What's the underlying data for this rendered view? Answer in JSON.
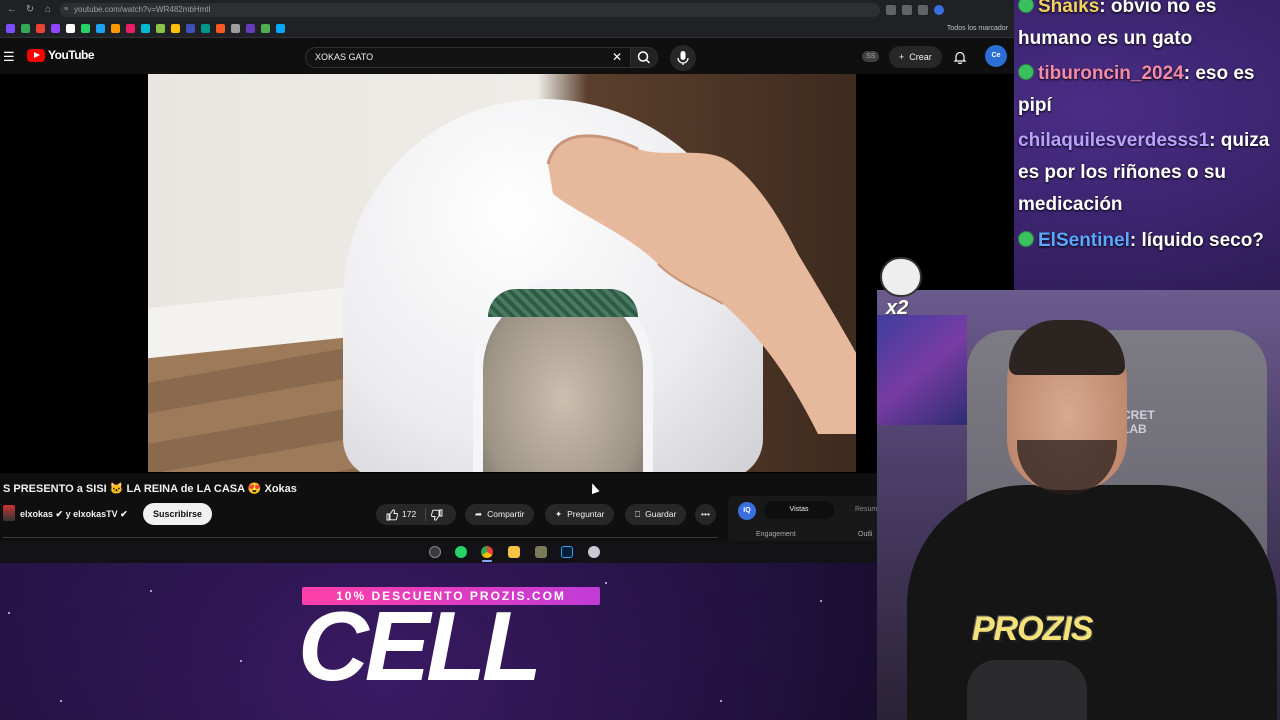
{
  "browser": {
    "url": "youtube.com/watch?v=WR482mbHmtI",
    "bookmarks_label": "Todos los marcador"
  },
  "youtube": {
    "logo_text": "YouTube",
    "search_query": "XOKAS GATO",
    "ss_badge": "SS",
    "create_label": "Crear",
    "avatar_text": "Ce"
  },
  "video": {
    "title": "S PRESENTO a SISI 🐱 LA REINA de LA CASA 😍 Xokas",
    "channel": "elxokas ✔ y elxokasTV ✔",
    "subscribe_label": "Suscribirse",
    "likes": "172",
    "share_label": "Compartir",
    "ask_label": "Preguntar",
    "save_label": "Guardar"
  },
  "extension_panel": {
    "logo": "IQ",
    "tab_active": "Vistas",
    "tab_2": "Resum",
    "label_1": "Engagement",
    "label_2": "Outli"
  },
  "promo": {
    "banner": "10% DESCUENTO PROZIS.COM",
    "title": "CELL"
  },
  "chat": {
    "messages": [
      {
        "user": "Shaiks",
        "text": ": obvio no es humano es un gato"
      },
      {
        "user": "tiburoncin_2024",
        "text": ": eso es pipí"
      },
      {
        "user": "chilaquilesverdesss1",
        "text": ": quiza es por los riñones o su medicación"
      },
      {
        "user": "ElSentinel",
        "text": ": líquido seco?"
      }
    ]
  },
  "webcam": {
    "chair_text": "CRET LAB",
    "shirt_text": "PROZIS"
  },
  "emote": {
    "multiplier": "x2"
  },
  "colors": {
    "yt_red": "#ff0000",
    "promo_pink": "#ff3fa8",
    "chat_badge_green": "#3cbf5e"
  }
}
